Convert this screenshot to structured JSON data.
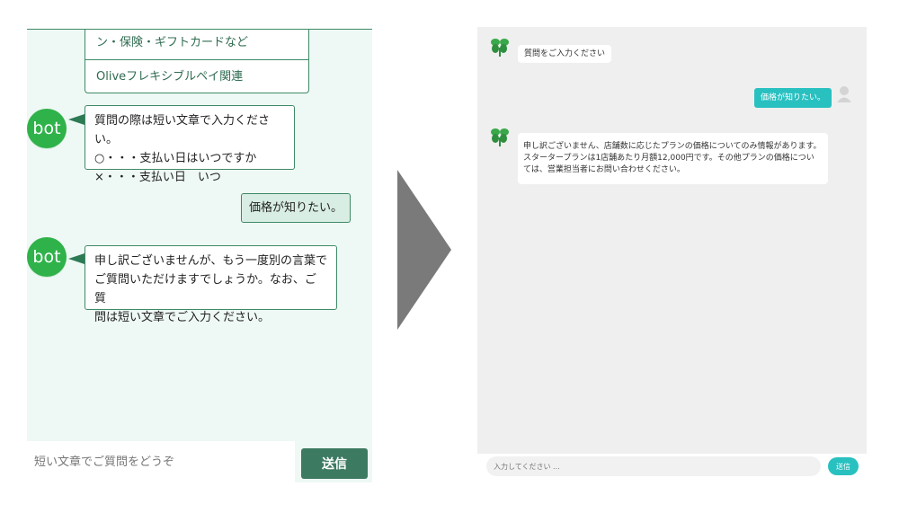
{
  "left": {
    "options": [
      "ン・保険・ギフトカードなど",
      "Oliveフレキシブルペイ関連"
    ],
    "bot_label": "bot",
    "bot1_lines": [
      "質問の際は短い文章で入力ください。",
      "○・・・支払い日はいつですか",
      "×・・・支払い日　いつ"
    ],
    "user_message": "価格が知りたい。",
    "bot2_lines": [
      "申し訳ございませんが、もう一度別の言葉で",
      "ご質問いただけますでしょうか。なお、ご質",
      "問は短い文章でご入力ください。"
    ],
    "input_placeholder": "短い文章でご質問をどうぞ",
    "send_label": "送信"
  },
  "right": {
    "greeting": "質問をご入力ください",
    "user_message": "価格が知りたい。",
    "bot_lines": [
      "申し訳ございません、店舗数に応じたプランの価格についてのみ情報があります。",
      "スタータープランは1店舗あたり月額12,000円です。その他プランの価格につい",
      "ては、営業担当者にお問い合わせください。"
    ],
    "input_placeholder": "入力してください ...",
    "send_label": "送信"
  },
  "colors": {
    "left_theme": "#3e8a66",
    "bot_green": "#2fb24a",
    "right_accent": "#29c0c0"
  }
}
